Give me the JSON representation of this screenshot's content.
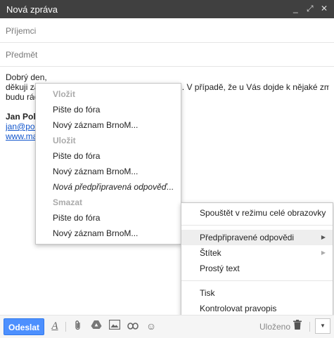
{
  "window": {
    "title": "Nová zpráva",
    "controls": [
      "_",
      "⤢",
      "✕"
    ]
  },
  "fields": {
    "recipients_placeholder": "Příjemci",
    "subject_placeholder": "Předmět"
  },
  "body": {
    "line1": "Dobrý den,",
    "line2": "děkuji za Váš zájem o náš produkt a spolupráci. V případě, že u Vás dojde k nějaké změně,",
    "line3": "budu rád, když mi dáte vědět.",
    "signature_name": "Jan Polz",
    "signature_email": "jan@polz",
    "signature_web": "www.ma"
  },
  "templates_menu": {
    "insert_header": "Vložit",
    "insert_items": [
      "Pište do fóra",
      "Nový záznam BrnoM..."
    ],
    "save_header": "Uložit",
    "save_items": [
      "Pište do fóra",
      "Nový záznam BrnoM...",
      "Nová předpřipravená odpověď..."
    ],
    "delete_header": "Smazat",
    "delete_items": [
      "Pište do fóra",
      "Nový záznam BrnoM..."
    ]
  },
  "options_menu": {
    "fullscreen": "Spouštět v režimu celé obrazovky",
    "canned": "Předpřipravené odpovědi",
    "label": "Štítek",
    "plain_text": "Prostý text",
    "print": "Tisk",
    "spellcheck": "Kontrolovat pravopis"
  },
  "toolbar": {
    "send_label": "Odeslat",
    "saved_label": "Uloženo",
    "icons": [
      "format-icon",
      "attach-icon",
      "drive-icon",
      "photo-icon",
      "link-icon",
      "emoji-icon",
      "trash-icon",
      "more-options-icon"
    ]
  },
  "colors": {
    "titlebar": "#404040",
    "send_button": "#4d90fe",
    "link": "#1155cc"
  }
}
